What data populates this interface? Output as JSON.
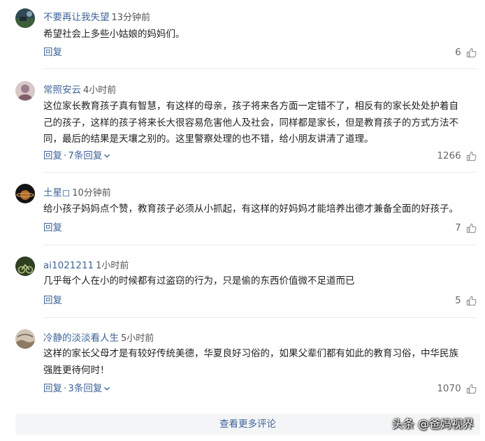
{
  "comments": [
    {
      "username": "不要再让我失望",
      "time": "13分钟前",
      "lines": [
        "希望社会上多些小姑娘的妈妈们。"
      ],
      "reply_label": "回复",
      "replies_label": "",
      "likes": "6"
    },
    {
      "username": "常照安云",
      "time": "4小时前",
      "lines": [
        "这位家长教育孩子真有智慧，有这样的母亲，孩子将来各方面一定错不了，相反有的家长处处护着自",
        "己的孩子，这样的孩子将来长大很容易危害他人及社会，同样都是家长，但是教育孩子的方式方法不",
        "同，最后的结果是天壤之别的。这里警察处理的也不错，给小朋友讲清了道理。"
      ],
      "reply_label": "回复",
      "replies_label": "7条回复",
      "likes": "1266"
    },
    {
      "username": "土星◻",
      "time": "10分钟前",
      "lines": [
        "给小孩子妈妈点个赞，教育孩子必须从小抓起，有这样的好妈妈才能培养出德才兼备全面的好孩子。"
      ],
      "reply_label": "回复",
      "replies_label": "",
      "likes": "7"
    },
    {
      "username": "ai1021211",
      "time": "1小时前",
      "lines": [
        "几乎每个人在小的时候都有过盗窃的行为，只是偷的东西价值微不足道而已"
      ],
      "reply_label": "回复",
      "replies_label": "",
      "likes": "5"
    },
    {
      "username": "冷静的淡淡看人生",
      "time": "5小时前",
      "lines": [
        "这样的家长父母才是有较好传统美德，华夏良好习俗的，如果父辈们都有如此的教育习俗，中华民族",
        "强胜更待何时！"
      ],
      "reply_label": "回复",
      "replies_label": "3条回复",
      "likes": "1070"
    }
  ],
  "separator": "·",
  "more_label": "查看更多评论",
  "watermark": "头条 @爸妈视界",
  "colors": {
    "link": "#406599",
    "text": "#222222",
    "muted": "#555555",
    "divider": "#ececec",
    "more_bg": "#f4f5f6"
  },
  "icons": {
    "like": "thumbs-up-icon",
    "expand": "chevron-down-icon"
  }
}
